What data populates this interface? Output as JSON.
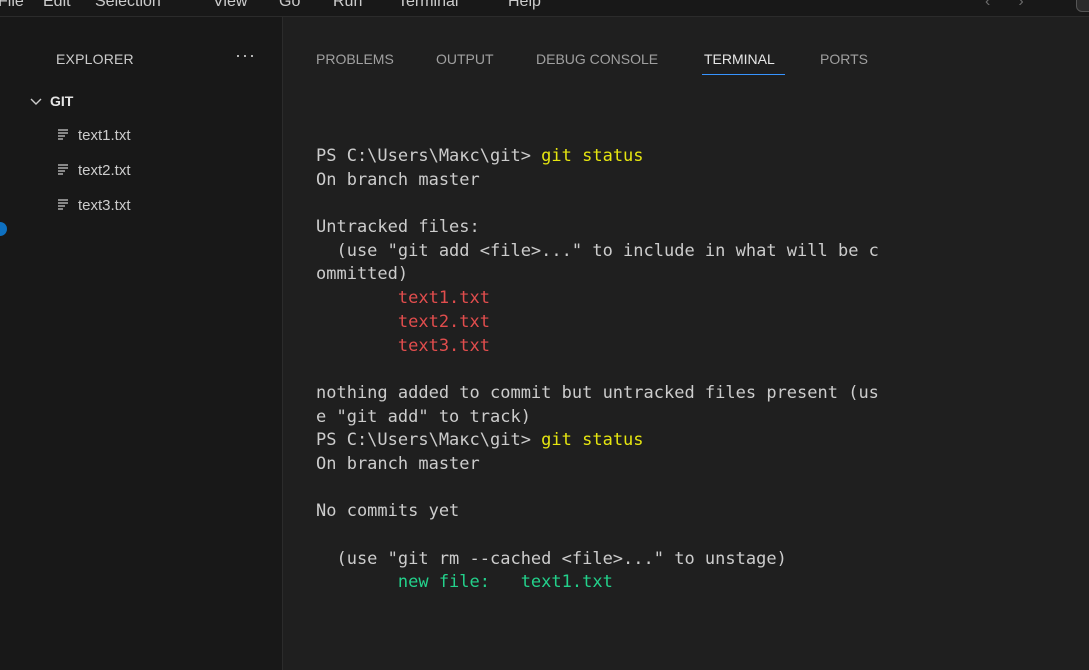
{
  "menubar": {
    "items": [
      "File",
      "Edit",
      "Selection",
      "View",
      "Go",
      "Run",
      "Terminal",
      "Help"
    ]
  },
  "sidebar": {
    "title": "EXPLORER",
    "more": "···",
    "folder": "GIT",
    "files": [
      "text1.txt",
      "text2.txt",
      "text3.txt"
    ]
  },
  "panel": {
    "tabs": [
      "PROBLEMS",
      "OUTPUT",
      "DEBUG CONSOLE",
      "TERMINAL",
      "PORTS"
    ],
    "active_tab": "TERMINAL"
  },
  "terminal": {
    "lines": [
      {
        "prefix": "PS C:\\Users\\Макс\\git> ",
        "cmd": "git status"
      },
      {
        "text": "On branch master"
      },
      {
        "text": ""
      },
      {
        "text": "Untracked files:"
      },
      {
        "text": "  (use \"git add <file>...\" to include in what will be c"
      },
      {
        "text": "ommitted)"
      },
      {
        "text": "        text1.txt",
        "color": "red"
      },
      {
        "text": "        text2.txt",
        "color": "red"
      },
      {
        "text": "        text3.txt",
        "color": "red"
      },
      {
        "text": ""
      },
      {
        "text": "nothing added to commit but untracked files present (us"
      },
      {
        "text": "e \"git add\" to track)"
      },
      {
        "prefix": "PS C:\\Users\\Макс\\git> ",
        "cmd": "git status"
      },
      {
        "text": "On branch master"
      },
      {
        "text": ""
      },
      {
        "text": "No commits yet"
      },
      {
        "text": ""
      },
      {
        "text": "  (use \"git rm --cached <file>...\" to unstage)"
      },
      {
        "text": "        new file:   text1.txt",
        "color": "green"
      }
    ]
  },
  "colors": {
    "background": "#1f1f1f",
    "sidebar": "#181818",
    "command": "#e5e510",
    "untracked": "#e14d4d",
    "staged": "#23d18b",
    "accent": "#3794ff"
  }
}
